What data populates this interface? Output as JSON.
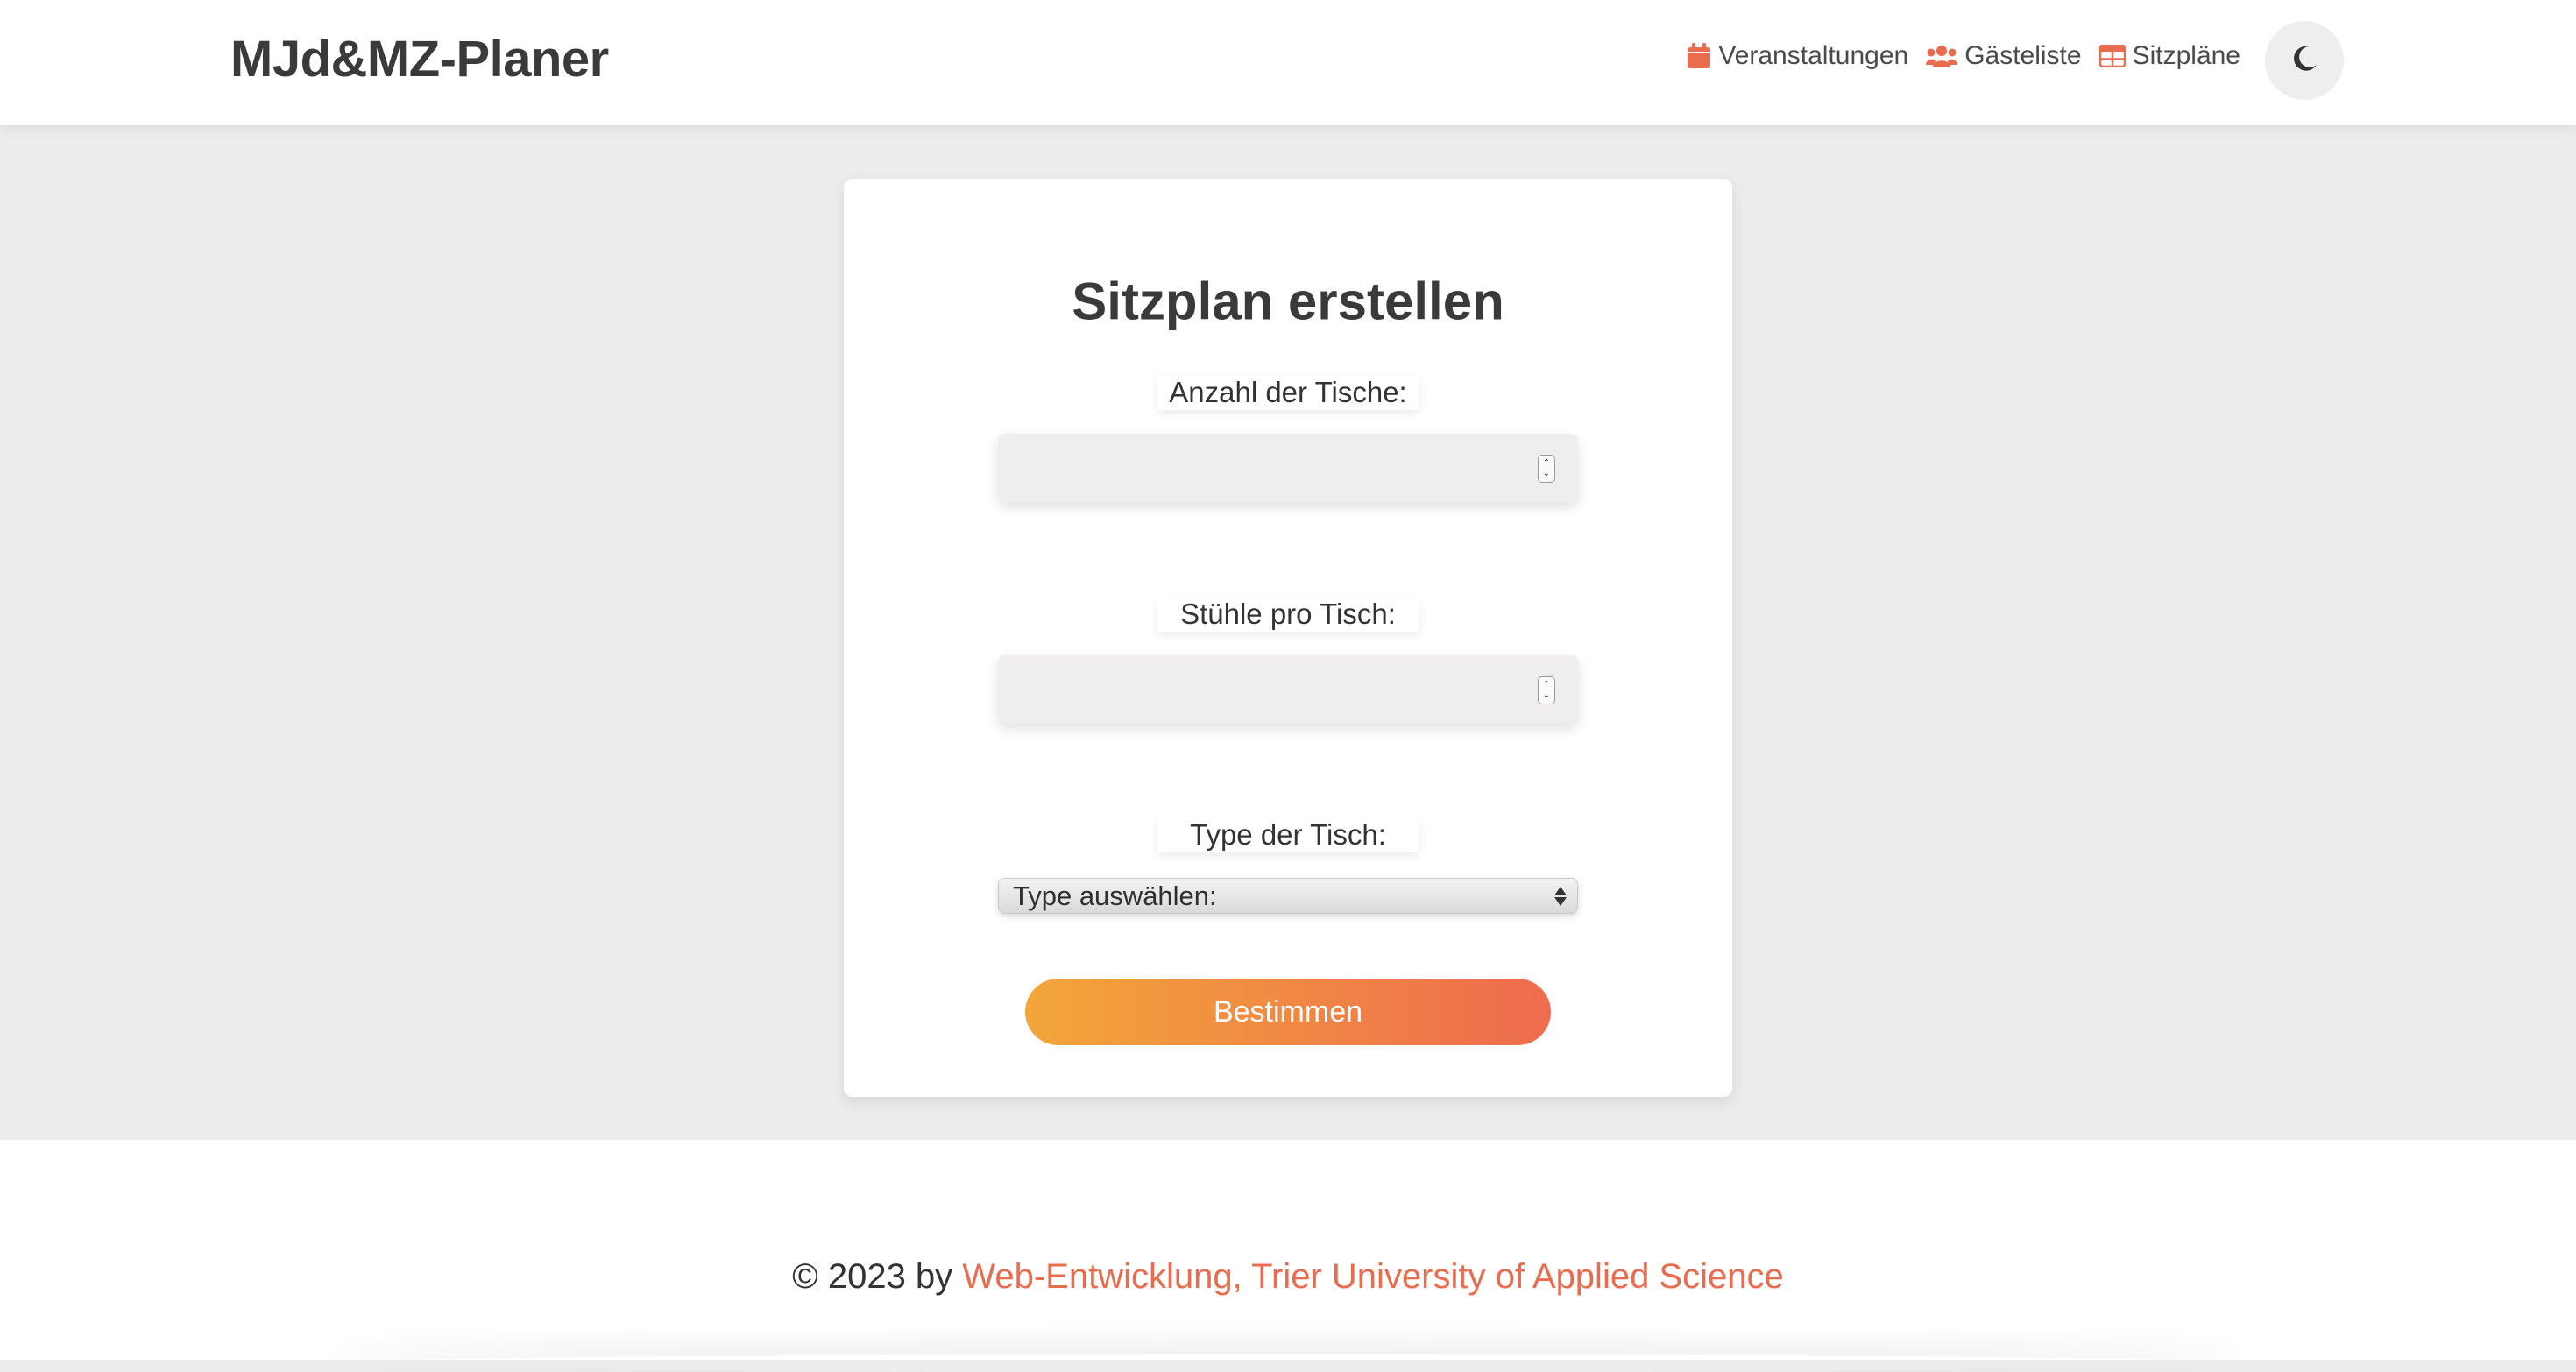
{
  "header": {
    "brand": "MJd&MZ-Planer",
    "nav": [
      {
        "label": "Veranstaltungen",
        "icon": "calendar-icon"
      },
      {
        "label": "Gästeliste",
        "icon": "users-icon"
      },
      {
        "label": "Sitzpläne",
        "icon": "table-icon"
      }
    ],
    "theme_toggle_icon": "moon-icon"
  },
  "form": {
    "title": "Sitzplan erstellen",
    "tables_label": "Anzahl der Tische:",
    "tables_value": "",
    "chairs_label": "Stühle pro Tisch:",
    "chairs_value": "",
    "type_label": "Type der Tisch:",
    "type_selected": "Type auswählen:",
    "submit_label": "Bestimmen"
  },
  "footer": {
    "prefix": "© 2023 by ",
    "link": "Web-Entwicklung, Trier University of Applied Science"
  },
  "colors": {
    "accent": "#e96c4f",
    "button_gradient_start": "#f2a63a",
    "button_gradient_end": "#ef6b4e",
    "background": "#ededed"
  }
}
